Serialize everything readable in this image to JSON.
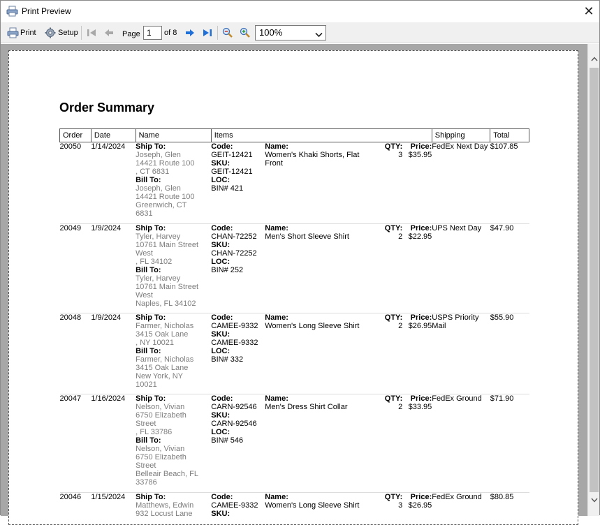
{
  "window": {
    "title": "Print Preview"
  },
  "toolbar": {
    "print_label": "Print",
    "setup_label": "Setup",
    "page_label": "Page",
    "page_value": "1",
    "of_label": "of 8",
    "zoom_value": "100%"
  },
  "report": {
    "title": "Order Summary",
    "columns": [
      "Order",
      "Date",
      "Name",
      "Items",
      "Shipping",
      "Total"
    ],
    "labels": {
      "ship_to": "Ship To:",
      "bill_to": "Bill To:",
      "code": "Code:",
      "sku": "SKU:",
      "loc": "LOC:",
      "name": "Name:",
      "qty": "QTY:",
      "price": "Price:"
    },
    "orders": [
      {
        "order": "20050",
        "date": "1/14/2024",
        "ship_to": [
          "Joseph, Glen",
          "14421 Route 100",
          ", CT 6831"
        ],
        "bill_to": [
          "Joseph, Glen",
          "14421 Route 100",
          "Greenwich, CT",
          "6831"
        ],
        "code": "GEIT-12421",
        "sku": "GEIT-12421",
        "loc": "BIN# 421",
        "item_name": "Women's Khaki Shorts, Flat Front",
        "qty": "3",
        "price": "$35.95",
        "shipping": "FedEx Next Day",
        "total": "$107.85"
      },
      {
        "order": "20049",
        "date": "1/9/2024",
        "ship_to": [
          "Tyler, Harvey",
          "10761 Main Street",
          "West",
          ", FL 34102"
        ],
        "bill_to": [
          "Tyler, Harvey",
          "10761 Main Street",
          "West",
          "Naples, FL 34102"
        ],
        "code": "CHAN-72252",
        "sku": "CHAN-72252",
        "loc": "BIN# 252",
        "item_name": "Men's Short Sleeve Shirt",
        "qty": "2",
        "price": "$22.95",
        "shipping": "UPS Next Day",
        "total": "$47.90"
      },
      {
        "order": "20048",
        "date": "1/9/2024",
        "ship_to": [
          "Farmer, Nicholas",
          "3415 Oak Lane",
          ", NY 10021"
        ],
        "bill_to": [
          "Farmer, Nicholas",
          "3415 Oak Lane",
          "New York, NY",
          "10021"
        ],
        "code": "CAMEE-9332",
        "sku": "CAMEE-9332",
        "loc": "BIN# 332",
        "item_name": "Women's Long Sleeve Shirt",
        "qty": "2",
        "price": "$26.95",
        "shipping": "USPS Priority Mail",
        "total": "$55.90"
      },
      {
        "order": "20047",
        "date": "1/16/2024",
        "ship_to": [
          "Nelson, Vivian",
          "6750 Elizabeth",
          "Street",
          ", FL 33786"
        ],
        "bill_to": [
          "Nelson, Vivian",
          "6750 Elizabeth",
          "Street",
          "Belleair Beach, FL",
          "33786"
        ],
        "code": "CARN-92546",
        "sku": "CARN-92546",
        "loc": "BIN# 546",
        "item_name": "Men's Dress Shirt Collar",
        "qty": "2",
        "price": "$33.95",
        "shipping": "FedEx Ground",
        "total": "$71.90"
      },
      {
        "order": "20046",
        "date": "1/15/2024",
        "ship_to": [
          "Matthews, Edwin",
          "932 Locust Lane"
        ],
        "bill_to": [],
        "code": "CAMEE-9332",
        "sku": "",
        "loc": "",
        "item_name": "Women's Long Sleeve Shirt",
        "qty": "3",
        "price": "$26.95",
        "shipping": "FedEx Ground",
        "total": "$80.85"
      }
    ]
  }
}
